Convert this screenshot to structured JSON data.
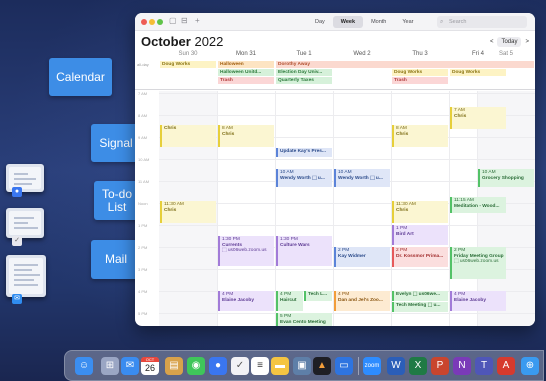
{
  "toolbar": {
    "add_label": "+",
    "views": [
      "Day",
      "Week",
      "Month",
      "Year"
    ],
    "active_view": "Week",
    "search_placeholder": "Search"
  },
  "calendar": {
    "month": "October",
    "year": "2022",
    "prev_label": "<",
    "today_label": "Today",
    "next_label": ">",
    "allday_label": "all-day",
    "days": [
      {
        "name": "Sun 30"
      },
      {
        "name": "Mon 31"
      },
      {
        "name": "Tue 1"
      },
      {
        "name": "Wed 2"
      },
      {
        "name": "Thu 3"
      },
      {
        "name": "Fri 4"
      },
      {
        "name": "Sat 5"
      }
    ],
    "hours": [
      "7 AM",
      "8 AM",
      "9 AM",
      "10 AM",
      "11 AM",
      "Noon",
      "1 PM",
      "2 PM",
      "3 PM",
      "4 PM",
      "5 PM",
      "6 PM"
    ],
    "allday_events": [
      {
        "text": "Doug Works"
      },
      {
        "text": "Halloween"
      },
      {
        "text": "Halloween Unitd..."
      },
      {
        "text": "Trash"
      },
      {
        "text": "Dorothy Away"
      },
      {
        "text": "Election Day Univ..."
      },
      {
        "text": "Quarterly Taxes"
      },
      {
        "text": "Doug Works"
      },
      {
        "text": "Trash"
      },
      {
        "text": "Doug Works"
      }
    ],
    "events": [
      {
        "time": "",
        "title": "Chris"
      },
      {
        "time": "8 AM",
        "title": "Chris"
      },
      {
        "time": "",
        "title": "Update Kay's Pres..."
      },
      {
        "time": "10 AM",
        "title": "Wendy Worth ⬚ u..."
      },
      {
        "time": "10 AM",
        "title": "Wendy Worth ⬚ u..."
      },
      {
        "time": "8 AM",
        "title": "Chris"
      },
      {
        "time": "7 AM",
        "title": "Chris"
      },
      {
        "time": "10 AM",
        "title": "Grocery Shopping"
      },
      {
        "time": "11:30 AM",
        "title": "Chris"
      },
      {
        "time": "11:30 AM",
        "title": "Chris"
      },
      {
        "time": "11:15 AM",
        "title": "Meditation - Wood..."
      },
      {
        "time": "1:30 PM",
        "title": "Currents",
        "extra": "⬚ us06web.zoom.us"
      },
      {
        "time": "1:30 PM",
        "title": "Culture Wars"
      },
      {
        "time": "2 PM",
        "title": "Kay Widmer"
      },
      {
        "time": "1 PM",
        "title": "Bird Art"
      },
      {
        "time": "2 PM",
        "title": "Dr. Kossmor Prima..."
      },
      {
        "time": "2 PM",
        "title": "Friday Meeting Group",
        "extra": "⬚ us06web.zoom.us"
      },
      {
        "time": "4 PM",
        "title": "Elaine Jacoby"
      },
      {
        "time": "4 PM",
        "title": "Haircut"
      },
      {
        "time": "",
        "title": "Tech L..."
      },
      {
        "time": "4 PM",
        "title": "Dan and Jel's Zoo..."
      },
      {
        "time": "",
        "title": "Evelyn ⬚ us06we..."
      },
      {
        "time": "",
        "title": "Tech Meeting ⬚ u..."
      },
      {
        "time": "4 PM",
        "title": "Elaine Jacoby"
      },
      {
        "time": "5 PM",
        "title": "Evan Cento Meeting"
      }
    ]
  },
  "callouts": {
    "calendar": "Calendar",
    "signal": "Signal",
    "todo": "To-do List",
    "mail": "Mail"
  },
  "dock": {
    "calendar_date": "26",
    "calendar_month": "OCT"
  },
  "colors": {
    "callout_blue": "#3d8de6",
    "purple": "#a27bd8",
    "yellow": "#e6cf3a",
    "green": "#53c267",
    "red": "#e65a5a",
    "orange": "#f29d3a",
    "blue": "#5b83d8"
  }
}
